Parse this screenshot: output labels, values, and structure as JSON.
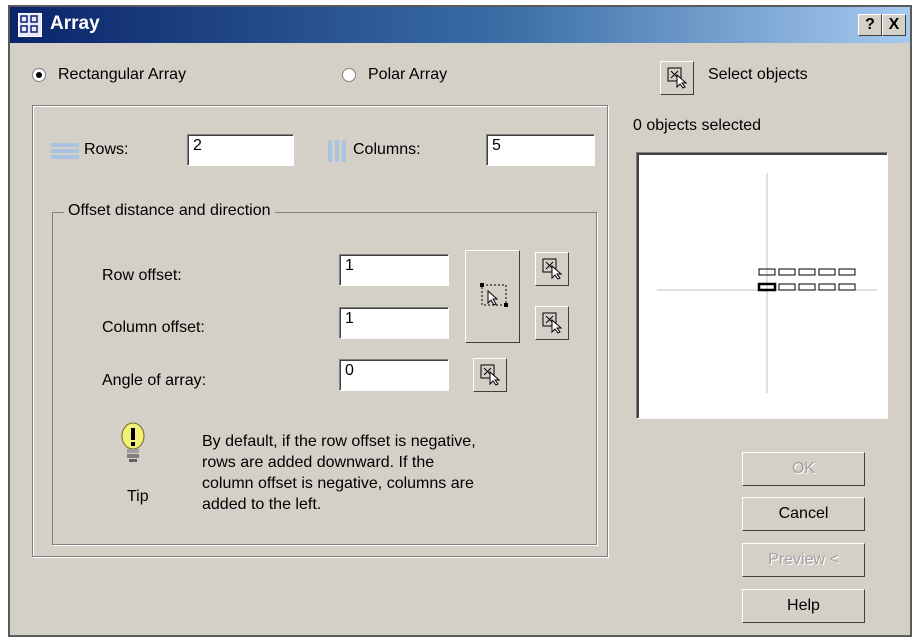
{
  "window": {
    "title": "Array"
  },
  "titlebar_buttons": {
    "help": "?",
    "close": "X"
  },
  "mode": {
    "rectangular_label": "Rectangular Array",
    "polar_label": "Polar Array",
    "selected": "Rectangular Array"
  },
  "selection": {
    "select_objects_label": "Select objects",
    "count_text": "0 objects selected"
  },
  "grid": {
    "rows_label": "Rows:",
    "rows_value": "2",
    "columns_label": "Columns:",
    "columns_value": "5"
  },
  "offset": {
    "group_title": "Offset distance and direction",
    "row_offset_label": "Row offset:",
    "row_offset_value": "1",
    "column_offset_label": "Column offset:",
    "column_offset_value": "1",
    "angle_label": "Angle of array:",
    "angle_value": "0"
  },
  "tip": {
    "label": "Tip",
    "lines": [
      "By default, if the row offset is negative,",
      "rows are added downward.  If the",
      "column offset is negative, columns are",
      "added to the left."
    ]
  },
  "buttons": {
    "ok": "OK",
    "cancel": "Cancel",
    "preview": "Preview <",
    "help": "Help"
  },
  "icons": {
    "app": "array-app-icon",
    "pick": "pick-cursor-icon",
    "rows": "rows-icon",
    "columns": "columns-icon",
    "tip": "lightbulb-icon"
  },
  "colors": {
    "title_bar": "#0a246a",
    "face": "#d4d0c8",
    "field": "#ffffff",
    "disabled_text": "#a0a0a0"
  }
}
